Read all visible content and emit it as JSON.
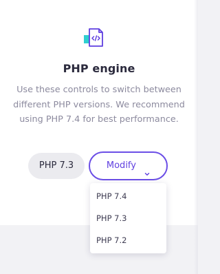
{
  "section": {
    "icon": "php-file-icon",
    "title": "PHP engine",
    "description": "Use these controls to switch between different PHP versions. We recommend using PHP 7.4 for best performance."
  },
  "controls": {
    "current_version": "PHP 7.3",
    "modify_label": "Modify",
    "modify_icon": "chevron-down-icon",
    "accent_color": "#6b4ee6"
  },
  "dropdown": {
    "options": [
      "PHP 7.4",
      "PHP 7.3",
      "PHP 7.2"
    ]
  }
}
